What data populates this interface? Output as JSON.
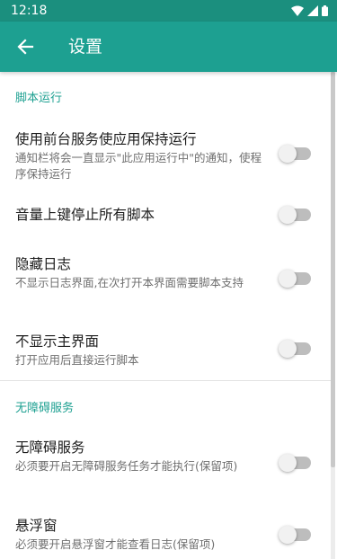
{
  "status_bar": {
    "time": "12:18"
  },
  "app_bar": {
    "title": "设置",
    "back_icon": "arrow-back-icon"
  },
  "sections": [
    {
      "header": "脚本运行",
      "items": [
        {
          "title": "使用前台服务使应用保持运行",
          "summary": "通知栏将会一直显示\"此应用运行中\"的通知，使程序保持运行",
          "enabled": false
        },
        {
          "title": "音量上键停止所有脚本",
          "summary": "",
          "enabled": false
        },
        {
          "title": "隐藏日志",
          "summary": "不显示日志界面,在次打开本界面需要脚本支持",
          "enabled": false
        },
        {
          "title": "不显示主界面",
          "summary": "打开应用后直接运行脚本",
          "enabled": false
        }
      ]
    },
    {
      "header": "无障碍服务",
      "items": [
        {
          "title": "无障碍服务",
          "summary": "必须要开启无障碍服务任务才能执行(保留项)",
          "enabled": false
        },
        {
          "title": "悬浮窗",
          "summary": "必须要开启悬浮窗才能查看日志(保留项)",
          "enabled": false
        }
      ]
    }
  ],
  "colors": {
    "status_bar": "#1b8f7e",
    "app_bar": "#1da091",
    "accent": "#1da091",
    "switch_track": "#bdbdbd",
    "switch_thumb": "#f1f1f1"
  }
}
